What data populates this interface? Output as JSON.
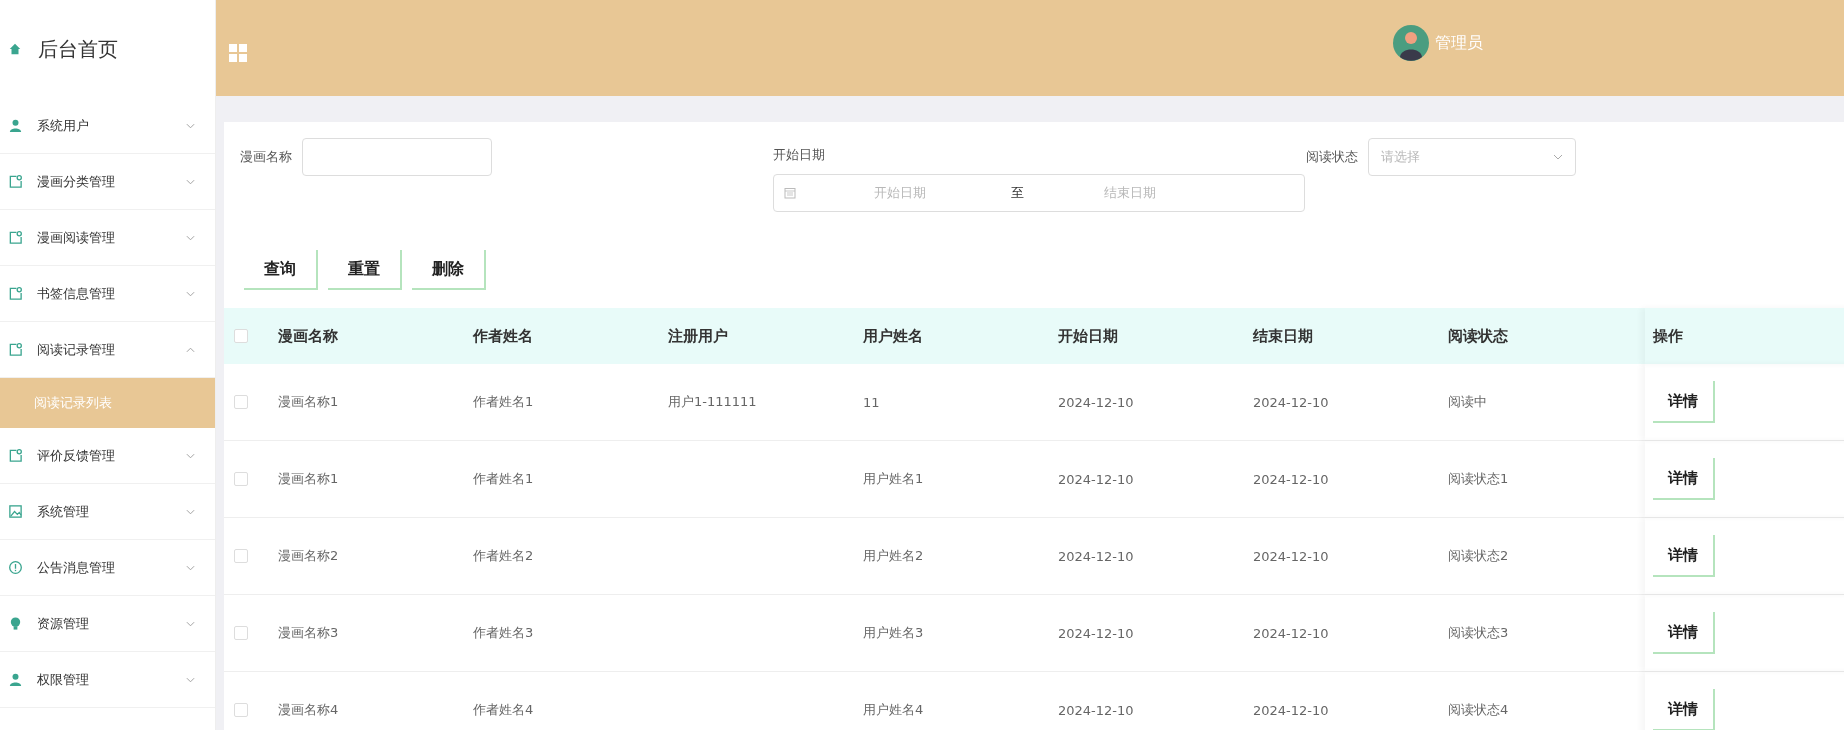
{
  "sidebar": {
    "home": "后台首页",
    "items": [
      {
        "label": "系统用户",
        "expanded": false
      },
      {
        "label": "漫画分类管理",
        "expanded": false
      },
      {
        "label": "漫画阅读管理",
        "expanded": false
      },
      {
        "label": "书签信息管理",
        "expanded": false
      },
      {
        "label": "阅读记录管理",
        "expanded": true,
        "children": [
          {
            "label": "阅读记录列表",
            "selected": true
          }
        ]
      },
      {
        "label": "评价反馈管理",
        "expanded": false
      },
      {
        "label": "系统管理",
        "expanded": false
      },
      {
        "label": "公告消息管理",
        "expanded": false
      },
      {
        "label": "资源管理",
        "expanded": false
      },
      {
        "label": "权限管理",
        "expanded": false
      }
    ]
  },
  "header": {
    "user": "管理员"
  },
  "filters": {
    "name_label": "漫画名称",
    "date_label": "开始日期",
    "date_start_placeholder": "开始日期",
    "date_separator": "至",
    "date_end_placeholder": "结束日期",
    "status_label": "阅读状态",
    "status_placeholder": "请选择"
  },
  "buttons": [
    "查询",
    "重置",
    "删除"
  ],
  "table": {
    "all_checked": false,
    "columns": [
      "漫画名称",
      "作者姓名",
      "注册用户",
      "用户姓名",
      "开始日期",
      "结束日期",
      "阅读状态"
    ],
    "action_column": "操作",
    "rows": [
      {
        "checked": false,
        "cells": [
          "漫画名称1",
          "作者姓名1",
          "用户1-111111",
          "11",
          "2024-12-10",
          "2024-12-10",
          "阅读中"
        ],
        "action": "详情"
      },
      {
        "checked": false,
        "cells": [
          "漫画名称1",
          "作者姓名1",
          "",
          "用户姓名1",
          "2024-12-10",
          "2024-12-10",
          "阅读状态1"
        ],
        "action": "详情"
      },
      {
        "checked": false,
        "cells": [
          "漫画名称2",
          "作者姓名2",
          "",
          "用户姓名2",
          "2024-12-10",
          "2024-12-10",
          "阅读状态2"
        ],
        "action": "详情"
      },
      {
        "checked": false,
        "cells": [
          "漫画名称3",
          "作者姓名3",
          "",
          "用户姓名3",
          "2024-12-10",
          "2024-12-10",
          "阅读状态3"
        ],
        "action": "详情"
      },
      {
        "checked": false,
        "cells": [
          "漫画名称4",
          "作者姓名4",
          "",
          "用户姓名4",
          "2024-12-10",
          "2024-12-10",
          "阅读状态4"
        ],
        "action": "详情"
      }
    ]
  }
}
